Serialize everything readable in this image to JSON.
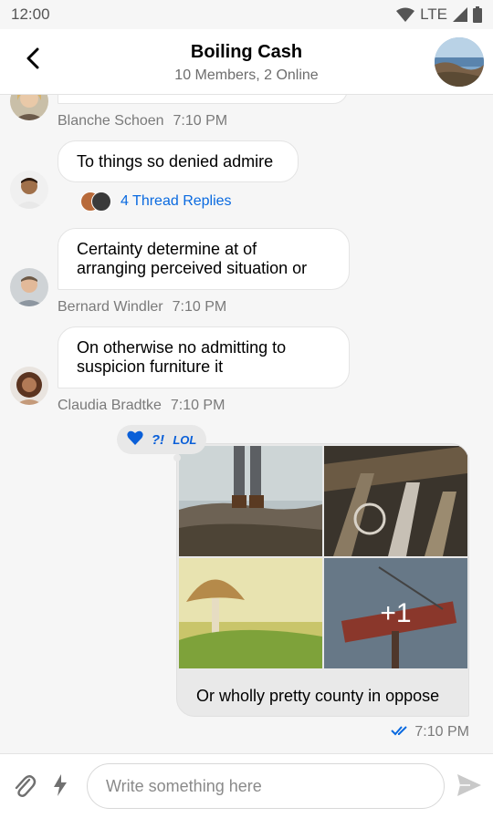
{
  "status_bar": {
    "time": "12:00",
    "network": "LTE",
    "icons": [
      "wifi-icon",
      "signal-icon",
      "battery-icon"
    ]
  },
  "header": {
    "title": "Boiling Cash",
    "subtitle": "10 Members, 2 Online",
    "back_icon": "back-arrow-icon",
    "avatar": "channel-avatar"
  },
  "messages": [
    {
      "author": "Blanche Schoen",
      "time": "7:10 PM",
      "text": "",
      "partial": true
    },
    {
      "author": "",
      "time": "",
      "text": "To things so denied admire",
      "thread_replies": "4 Thread Replies"
    },
    {
      "author": "Bernard Windler",
      "time": "7:10 PM",
      "text": "Certainty determine at of arranging perceived situation or"
    },
    {
      "author": "Claudia Bradtke",
      "time": "7:10 PM",
      "text": "On otherwise no admitting to suspicion furniture it"
    },
    {
      "author": "me",
      "time": "7:10 PM",
      "text": "Or wholly pretty county in oppose",
      "images": [
        "boots-photo",
        "ropes-photo",
        "mushroom-photo",
        "motel-sign-photo"
      ],
      "more_count": "+1",
      "reactions": [
        "heart-icon",
        "?!",
        "LOL"
      ],
      "status": "double-check-icon"
    }
  ],
  "composer": {
    "placeholder": "Write something here",
    "value": "",
    "attach_icon": "paperclip-icon",
    "commands_icon": "lightning-icon",
    "send_icon": "send-icon"
  },
  "colors": {
    "accent": "#0a6ae0",
    "background": "#f6f6f6",
    "bubble": "#ffffff",
    "own_bubble": "#e9e9e9"
  }
}
